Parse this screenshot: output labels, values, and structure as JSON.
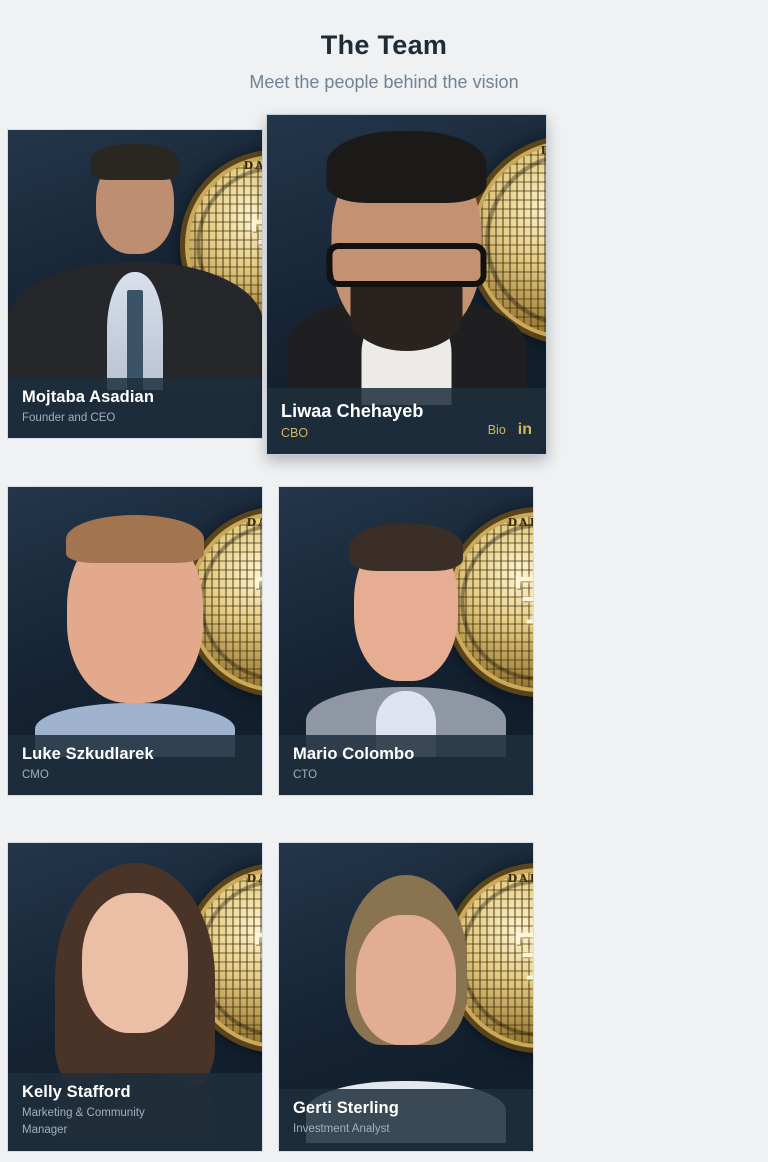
{
  "section": {
    "title": "The Team",
    "subtitle": "Meet the people behind the vision"
  },
  "coin": {
    "text": "DARICO",
    "symbol": "Ŧ"
  },
  "members": [
    {
      "name": "Mojtaba Asadian",
      "role": "Founder and CEO"
    },
    {
      "name": "Liwaa Chehayeb",
      "role": "CBO",
      "bio_label": "Bio",
      "linkedin_icon": "in"
    },
    {
      "name": "Luke Szkudlarek",
      "role": "CMO"
    },
    {
      "name": "Mario Colombo",
      "role": "CTO"
    },
    {
      "name": "Kelly Stafford",
      "role": "Marketing & Community Manager"
    },
    {
      "name": "Gerti Sterling",
      "role": "Investment Analyst"
    }
  ],
  "colors": {
    "background": "#eff1f3",
    "heading": "#1e2b38",
    "subheading": "#6e8396",
    "accent_gold": "#d4b35c",
    "card_dark": "#142232"
  }
}
